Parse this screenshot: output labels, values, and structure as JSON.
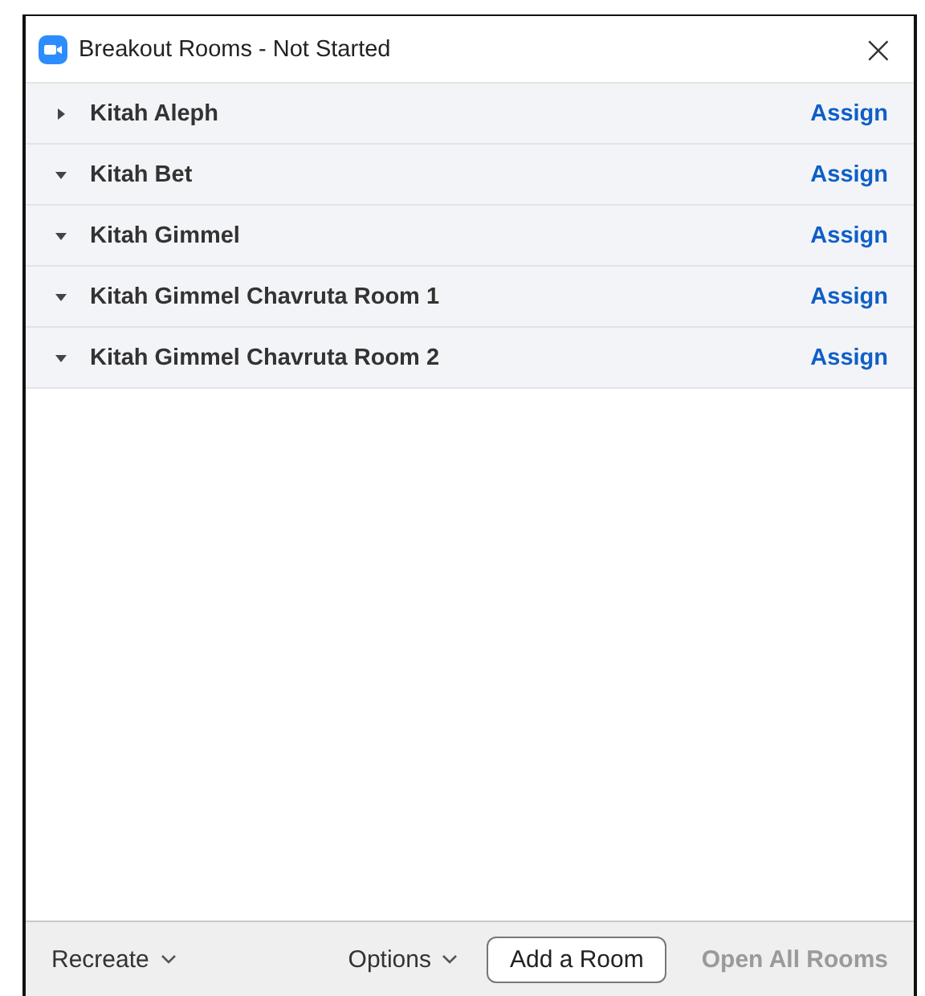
{
  "window": {
    "title": "Breakout Rooms - Not Started",
    "close": "×"
  },
  "rooms": [
    {
      "name": "Kitah Aleph",
      "expanded": false,
      "action": "Assign"
    },
    {
      "name": "Kitah Bet",
      "expanded": true,
      "action": "Assign"
    },
    {
      "name": "Kitah Gimmel",
      "expanded": true,
      "action": "Assign"
    },
    {
      "name": "Kitah Gimmel Chavruta Room 1",
      "expanded": true,
      "action": "Assign"
    },
    {
      "name": "Kitah Gimmel Chavruta Room 2",
      "expanded": true,
      "action": "Assign"
    }
  ],
  "footer": [
    {
      "kind": "dropdown",
      "label": "Recreate",
      "disabled": false
    },
    {
      "kind": "dropdown",
      "label": "Options",
      "disabled": false
    },
    {
      "kind": "outlined",
      "label": "Add a Room",
      "disabled": false
    },
    {
      "kind": "plain",
      "label": "Open All Rooms",
      "disabled": true
    }
  ]
}
